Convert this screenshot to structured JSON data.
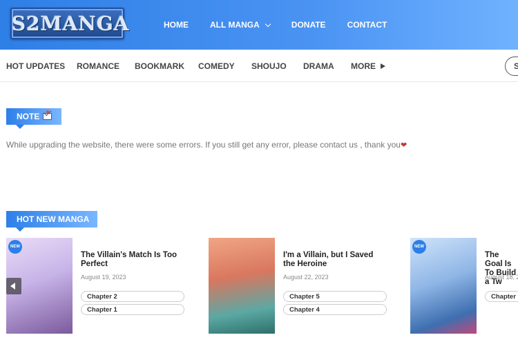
{
  "header": {
    "logo": "S2MANGA",
    "nav": [
      "HOME",
      "ALL MANGA",
      "DONATE",
      "CONTACT"
    ]
  },
  "subnav": {
    "items": [
      "HOT UPDATES",
      "ROMANCE",
      "BOOKMARK",
      "COMEDY",
      "SHOUJO",
      "DRAMA",
      "MORE"
    ],
    "search_partial": "S"
  },
  "note": {
    "title": "NOTE",
    "message": "While upgrading the website, there were some errors. If you still get any error, please contact us , thank you"
  },
  "hot_new": {
    "title": "HOT NEW MANGA",
    "cards": [
      {
        "badge": "NEW",
        "title": "The Villain's Match Is Too Perfect",
        "date": "August 19, 2023",
        "chapters": [
          "Chapter 2",
          "Chapter 1"
        ],
        "cover": "#c7b3e8"
      },
      {
        "badge": "",
        "title": "I'm a Villain, but I Saved the Heroine",
        "date": "August 22, 2023",
        "chapters": [
          "Chapter 5",
          "Chapter 4"
        ],
        "cover": "#d9775f"
      },
      {
        "badge": "NEW",
        "title": "The Goal Is To Build a Tw",
        "date": "August 18, 2",
        "chapters": [
          "Chapter"
        ],
        "cover": "#8fb6e6"
      }
    ]
  },
  "colors": {
    "accent": "#2d7fe8",
    "header_end": "#6fb2ff"
  }
}
